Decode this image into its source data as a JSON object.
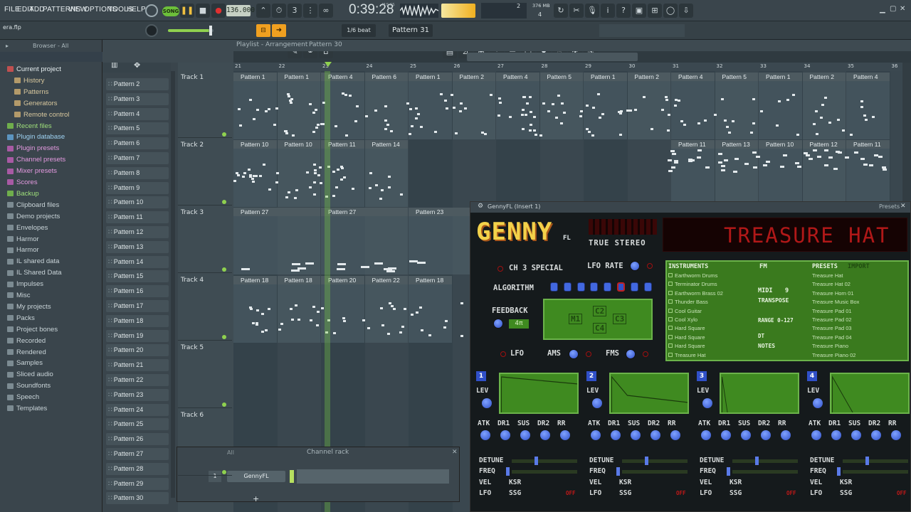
{
  "menu": [
    "FILE",
    "EDIT",
    "ADD",
    "PATTERNS",
    "VIEW",
    "OPTIONS",
    "TOOLS",
    "HELP"
  ],
  "transport": {
    "mode": "SONG",
    "tempo": "136.000",
    "time": "0:39:28",
    "time_label": "M:S:CS",
    "memory": "376 MB",
    "cpu": "2",
    "voices": "4"
  },
  "toolbar2": {
    "file": "era.flp",
    "snap": "1/6 beat",
    "pattern": "Pattern 31"
  },
  "browser": {
    "title": "Browser - All",
    "items": [
      {
        "label": "Current project",
        "color": "#e6eef0",
        "icon": "#c05050",
        "indent": 0
      },
      {
        "label": "History",
        "color": "#d8c89e",
        "icon": "#b39a6a",
        "indent": 1
      },
      {
        "label": "Patterns",
        "color": "#d8c89e",
        "icon": "#b39a6a",
        "indent": 1
      },
      {
        "label": "Generators",
        "color": "#d8c89e",
        "icon": "#b39a6a",
        "indent": 1
      },
      {
        "label": "Remote control",
        "color": "#d8c89e",
        "icon": "#b39a6a",
        "indent": 1
      },
      {
        "label": "Recent files",
        "color": "#9fe07a",
        "icon": "#6fae4c",
        "indent": 0
      },
      {
        "label": "Plugin database",
        "color": "#9ed2f2",
        "icon": "#5c95c0",
        "indent": 0
      },
      {
        "label": "Plugin presets",
        "color": "#e49ae0",
        "icon": "#a85aa4",
        "indent": 0
      },
      {
        "label": "Channel presets",
        "color": "#e49ae0",
        "icon": "#a85aa4",
        "indent": 0
      },
      {
        "label": "Mixer presets",
        "color": "#e49ae0",
        "icon": "#a85aa4",
        "indent": 0
      },
      {
        "label": "Scores",
        "color": "#e49ae0",
        "icon": "#a85aa4",
        "indent": 0
      },
      {
        "label": "Backup",
        "color": "#9fe07a",
        "icon": "#6fae4c",
        "indent": 0
      },
      {
        "label": "Clipboard files",
        "color": "#c9d4d8",
        "icon": "#7c8b92",
        "indent": 0
      },
      {
        "label": "Demo projects",
        "color": "#c9d4d8",
        "icon": "#7c8b92",
        "indent": 0
      },
      {
        "label": "Envelopes",
        "color": "#c9d4d8",
        "icon": "#7c8b92",
        "indent": 0
      },
      {
        "label": "Harmor",
        "color": "#c9d4d8",
        "icon": "#7c8b92",
        "indent": 0
      },
      {
        "label": "Harmor",
        "color": "#c9d4d8",
        "icon": "#7c8b92",
        "indent": 0
      },
      {
        "label": "IL shared data",
        "color": "#c9d4d8",
        "icon": "#7c8b92",
        "indent": 0
      },
      {
        "label": "IL Shared Data",
        "color": "#c9d4d8",
        "icon": "#7c8b92",
        "indent": 0
      },
      {
        "label": "Impulses",
        "color": "#c9d4d8",
        "icon": "#7c8b92",
        "indent": 0
      },
      {
        "label": "Misc",
        "color": "#c9d4d8",
        "icon": "#7c8b92",
        "indent": 0
      },
      {
        "label": "My projects",
        "color": "#c9d4d8",
        "icon": "#7c8b92",
        "indent": 0
      },
      {
        "label": "Packs",
        "color": "#c9d4d8",
        "icon": "#7c8b92",
        "indent": 0
      },
      {
        "label": "Project bones",
        "color": "#c9d4d8",
        "icon": "#7c8b92",
        "indent": 0
      },
      {
        "label": "Recorded",
        "color": "#c9d4d8",
        "icon": "#7c8b92",
        "indent": 0
      },
      {
        "label": "Rendered",
        "color": "#c9d4d8",
        "icon": "#7c8b92",
        "indent": 0
      },
      {
        "label": "Samples",
        "color": "#c9d4d8",
        "icon": "#7c8b92",
        "indent": 0
      },
      {
        "label": "Sliced audio",
        "color": "#c9d4d8",
        "icon": "#7c8b92",
        "indent": 0
      },
      {
        "label": "Soundfonts",
        "color": "#c9d4d8",
        "icon": "#7c8b92",
        "indent": 0
      },
      {
        "label": "Speech",
        "color": "#c9d4d8",
        "icon": "#7c8b92",
        "indent": 0
      },
      {
        "label": "Templates",
        "color": "#c9d4d8",
        "icon": "#7c8b92",
        "indent": 0
      }
    ]
  },
  "patterns": [
    "Pattern 2",
    "Pattern 3",
    "Pattern 4",
    "Pattern 5",
    "Pattern 6",
    "Pattern 7",
    "Pattern 8",
    "Pattern 9",
    "Pattern 10",
    "Pattern 11",
    "Pattern 12",
    "Pattern 13",
    "Pattern 14",
    "Pattern 15",
    "Pattern 16",
    "Pattern 17",
    "Pattern 18",
    "Pattern 19",
    "Pattern 20",
    "Pattern 21",
    "Pattern 22",
    "Pattern 23",
    "Pattern 24",
    "Pattern 25",
    "Pattern 26",
    "Pattern 27",
    "Pattern 28",
    "Pattern 29",
    "Pattern 30"
  ],
  "playlist": {
    "title": "Playlist - Arrangement",
    "pattern": "Pattern 30",
    "bars": [
      "21",
      "22",
      "23",
      "24",
      "25",
      "26",
      "27",
      "28",
      "29",
      "30",
      "31",
      "32",
      "33",
      "34",
      "35",
      "36"
    ],
    "tracks": [
      "Track 1",
      "Track 2",
      "Track 3",
      "Track 4",
      "Track 5",
      "Track 6"
    ],
    "track1_clips": [
      "Pattern 1",
      "Pattern 1",
      "Pattern 4",
      "Pattern 6",
      "Pattern 1",
      "Pattern 2",
      "Pattern 4",
      "Pattern 5",
      "Pattern 1",
      "Pattern 2",
      "Pattern 4",
      "Pattern 5",
      "Pattern 1",
      "Pattern 2",
      "Pattern 4"
    ],
    "track2_clips": [
      "Pattern 10",
      "Pattern 10",
      "Pattern 11",
      "Pattern 14",
      "Pattern 11",
      "Pattern 13",
      "Pattern 10",
      "Pattern 12",
      "Pattern 11"
    ],
    "track3_clips": [
      "Pattern 27",
      "Pattern 27",
      "Pattern 23"
    ],
    "track4_clips": [
      "Pattern 18",
      "Pattern 18",
      "Pattern 20",
      "Pattern 22",
      "Pattern 18"
    ]
  },
  "channel_rack": {
    "title": "Channel rack",
    "filter": "All",
    "number": "1",
    "channel": "GennyFL"
  },
  "genny": {
    "window_title": "GennyFL (Insert 1)",
    "presets_label": "Presets",
    "logo": "GENNY",
    "logo_sub": "FL",
    "true_stereo": "TRUE STEREO",
    "display": "TREASURE HAT",
    "ch3": "CH 3 SPECIAL",
    "lfo_rate": "LFO RATE",
    "algorithm": "ALGORITHM",
    "feedback": "FEEDBACK",
    "feedback_val": "4π",
    "lfo": "LFO",
    "ams": "AMS",
    "fms": "FMS",
    "ops": [
      "M1",
      "C2",
      "C3",
      "C4"
    ],
    "instruments_tab": "INSTRUMENTS",
    "presets_tab": "PRESETS",
    "import_tab": "IMPORT",
    "fm_tab": "FM",
    "instruments": [
      "Earthworm Drums",
      "Terminator Drums",
      "Earthworm Brass 02",
      "Thunder Bass",
      "Cool Guitar",
      "Cool Xylo",
      "Hard Square",
      "Hard Square",
      "Hard Square",
      "Treasure Hat"
    ],
    "presets": [
      "Treasure Hat",
      "Treasure Hat 02",
      "Treasure Horn 01",
      "Treasure Music Box",
      "Treasure Pad 01",
      "Treasure Pad 02",
      "Treasure Pad 03",
      "Treasure Pad 04",
      "Treasure Piano",
      "Treasure Piano 02"
    ],
    "midi_label": "MIDI",
    "midi_val": "9",
    "transpose_label": "TRANSPOSE",
    "range_label": "RANGE 0-127",
    "dt_label": "DT",
    "notes_label": "NOTES",
    "op_labels": {
      "lev": "LEV",
      "atk": "ATK",
      "dr1": "DR1",
      "sus": "SUS",
      "dr2": "DR2",
      "rr": "RR",
      "detune": "DETUNE",
      "freq": "FREQ",
      "vel": "VEL",
      "ksr": "KSR",
      "lfo": "LFO",
      "ssg": "SSG",
      "off": "OFF"
    },
    "op_numbers": [
      "1",
      "2",
      "3",
      "4"
    ]
  },
  "colors": {
    "accent": "#8fd14f",
    "orange": "#f0a020",
    "panel_green": "#3f8a20",
    "display_red": "#b01818"
  }
}
